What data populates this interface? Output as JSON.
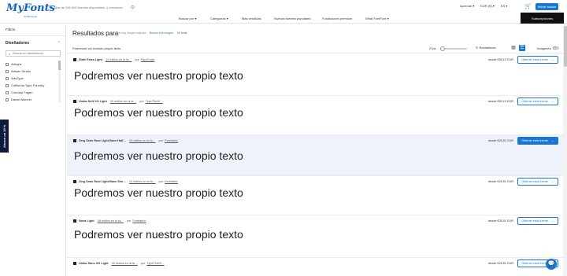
{
  "header": {
    "logo": "MyFonts",
    "logo_sub": "by Monotype",
    "search_placeholder": "Más de 300.000 fuentes disponibles, y creciendo",
    "topnav": [
      "Aprende ▾",
      "EUR (€) ▾",
      "ES ▾"
    ],
    "login": "Iniciar sesión"
  },
  "nav": {
    "items": [
      "Buscar por ▾",
      "Categorías ▾",
      "Más vendidas",
      "Nuevas fuentes populares",
      "Fundiciones premium",
      "What FontFont ▾"
    ],
    "subscriptions": "Subscripciones"
  },
  "sidebar": {
    "filters": "Filtros",
    "designers_title": "Diseñadores",
    "search_placeholder": "Buscar en diseñadores",
    "designers": [
      "Artegra",
      "Artisan Studio",
      "ArtsType",
      "California Type Foundry",
      "Connary Fagen",
      "Daniel Abecret"
    ],
    "promo": "Ahorre un 10 %"
  },
  "results": {
    "title": "Resultados para",
    "no_image": "No hay imagen adjunta",
    "search_by_image": "Buscar a la imagen",
    "count": "90 fonts"
  },
  "toolbar": {
    "preview_text": "Podremos ver nuestro propio texto",
    "size": "27px",
    "reset": "Restablecer",
    "images": "Imágenes",
    "grid_icon": "grid-icon",
    "list_icon": "list-icon",
    "slider_fraction": 0.1
  },
  "fonts": [
    {
      "name": "Slate Extra Light",
      "styles": "12 estilos en la fa…",
      "by": "por",
      "foundry": "FaraFonte",
      "price": "desde €38,10 EUR",
      "button": "Obtener esta fuente",
      "sample": "Podremos ver nuestro propio texto",
      "highlight": false
    },
    {
      "name": "Umba Soft XG Light",
      "styles": "30 estilos en la fa…",
      "by": "por",
      "foundry": "TypeThirtS…",
      "price": "desde €50,10 EUR",
      "button": "Obtener esta fuente",
      "sample": "Podremos ver nuestro propio texto",
      "highlight": false
    },
    {
      "name": "Zing Sans Rust Light Base Half…",
      "styles": "29 estilos en la fa…",
      "by": "por",
      "foundry": "Fontfabric",
      "price": "desde €26,51 EUR",
      "button": "Obtener esta fuente",
      "sample": "Podremos ver nuestro propio texto",
      "highlight": true
    },
    {
      "name": "Zing Sans Rust Light Base Sho…",
      "styles": "24 estilos en la fa…",
      "by": "por",
      "foundry": "Fontfabric",
      "price": "desde €26,51 EUR",
      "button": "Obtener esta fuente",
      "sample": "Podremos ver nuestro propio texto",
      "highlight": false
    },
    {
      "name": "Nova Light",
      "styles": "38 estilos en la fa…",
      "by": "por",
      "foundry": "Fontfabric",
      "price": "desde €26,51 EUR",
      "button": "Obtener esta fuente",
      "sample": "Podremos ver nuestro propio texto",
      "highlight": false
    },
    {
      "name": "Umba Sans XG Light",
      "styles": "30 estilos en la fa…",
      "by": "por",
      "foundry": "TypeThirtS…",
      "price": "desde €26,51 EUR",
      "button": "Obtener esta fuente",
      "sample": "",
      "highlight": false
    }
  ],
  "colors": {
    "accent": "#1976d2",
    "highlight_row": "#eef3fb",
    "promo": "#0d1b3e"
  }
}
